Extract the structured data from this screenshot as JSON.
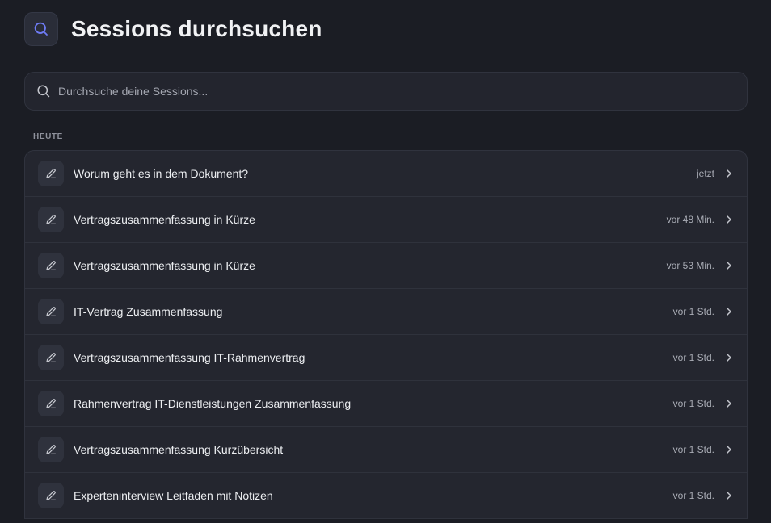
{
  "header": {
    "title": "Sessions durchsuchen",
    "icon": "search-icon",
    "accent_color": "#6f7cf6"
  },
  "search": {
    "placeholder": "Durchsuche deine Sessions...",
    "value": ""
  },
  "section": {
    "label": "HEUTE"
  },
  "sessions": [
    {
      "title": "Worum geht es in dem Dokument?",
      "time": "jetzt",
      "icon": "pencil-icon"
    },
    {
      "title": "Vertragszusammenfassung in Kürze",
      "time": "vor 48 Min.",
      "icon": "pencil-icon"
    },
    {
      "title": "Vertragszusammenfassung in Kürze",
      "time": "vor 53 Min.",
      "icon": "pencil-icon"
    },
    {
      "title": "IT-Vertrag Zusammenfassung",
      "time": "vor 1 Std.",
      "icon": "pencil-icon"
    },
    {
      "title": "Vertragszusammenfassung IT-Rahmenvertrag",
      "time": "vor 1 Std.",
      "icon": "pencil-icon"
    },
    {
      "title": "Rahmenvertrag IT-Dienstleistungen Zusammenfassung",
      "time": "vor 1 Std.",
      "icon": "pencil-icon"
    },
    {
      "title": "Vertragszusammenfassung Kurzübersicht",
      "time": "vor 1 Std.",
      "icon": "pencil-icon"
    },
    {
      "title": "Experteninterview Leitfaden mit Notizen",
      "time": "vor 1 Std.",
      "icon": "pencil-icon"
    }
  ]
}
